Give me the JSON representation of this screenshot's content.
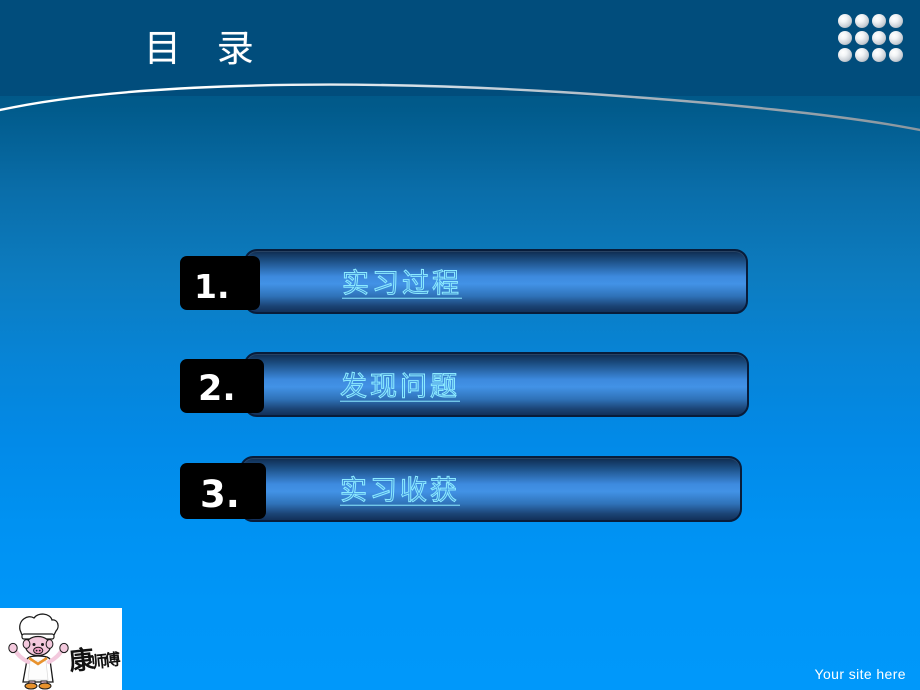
{
  "slide": {
    "title": "目 录",
    "background_top_color": "#014d7c",
    "background_bottom_color": "#0098fa"
  },
  "header": {
    "title": "目 录",
    "decoration": {
      "swoosh_icon": "curved-line-icon",
      "dot_grid_icon": "dot-grid-icon",
      "dot_count": 12,
      "dot_columns": 4,
      "dot_rows": 3
    }
  },
  "agenda": {
    "accent_text_color": "#8ceaff",
    "badge_color": "#000000",
    "items": [
      {
        "number": "1.",
        "label": "实习过程"
      },
      {
        "number": "2.",
        "label": "发现问题"
      },
      {
        "number": "3.",
        "label": "实习收获"
      }
    ]
  },
  "footer": {
    "logo": {
      "icon": "chef-mascot-logo",
      "brand_text": "康师傅"
    },
    "site_credit": "Your site here"
  }
}
